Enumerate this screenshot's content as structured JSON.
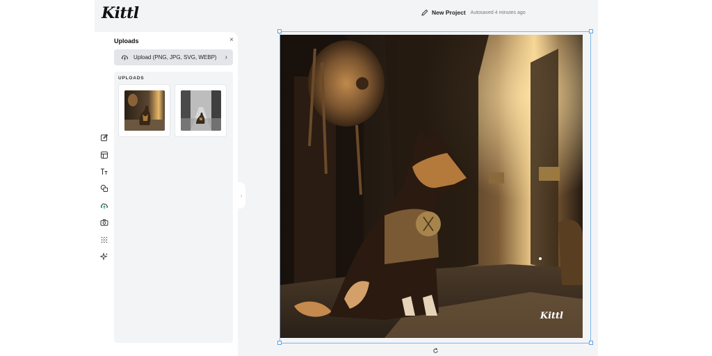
{
  "app": {
    "logo": "Kittl"
  },
  "header": {
    "project_name": "New Project",
    "autosave": "Autosaved 4 minutes ago"
  },
  "sidebar": {
    "icons": [
      {
        "name": "edit-icon"
      },
      {
        "name": "templates-icon"
      },
      {
        "name": "text-icon",
        "glyph": "Tt"
      },
      {
        "name": "shapes-icon"
      },
      {
        "name": "uploads-icon"
      },
      {
        "name": "camera-icon"
      },
      {
        "name": "pattern-icon"
      },
      {
        "name": "sparkle-icon"
      }
    ]
  },
  "panel": {
    "title": "Uploads",
    "close": "×",
    "upload_button": "Upload (PNG, JPG, SVG, WEBP)",
    "upload_chevron": "›",
    "section_title": "UPLOADS",
    "thumbs": [
      {
        "name": "dog-street-thumbnail"
      },
      {
        "name": "dog-road-thumbnail"
      }
    ]
  },
  "canvas": {
    "watermark": "Kittl",
    "handle": "›"
  },
  "colors": {
    "accent": "#5aa2dc",
    "panel": "#ffffff",
    "workspace": "#f3f4f6"
  }
}
